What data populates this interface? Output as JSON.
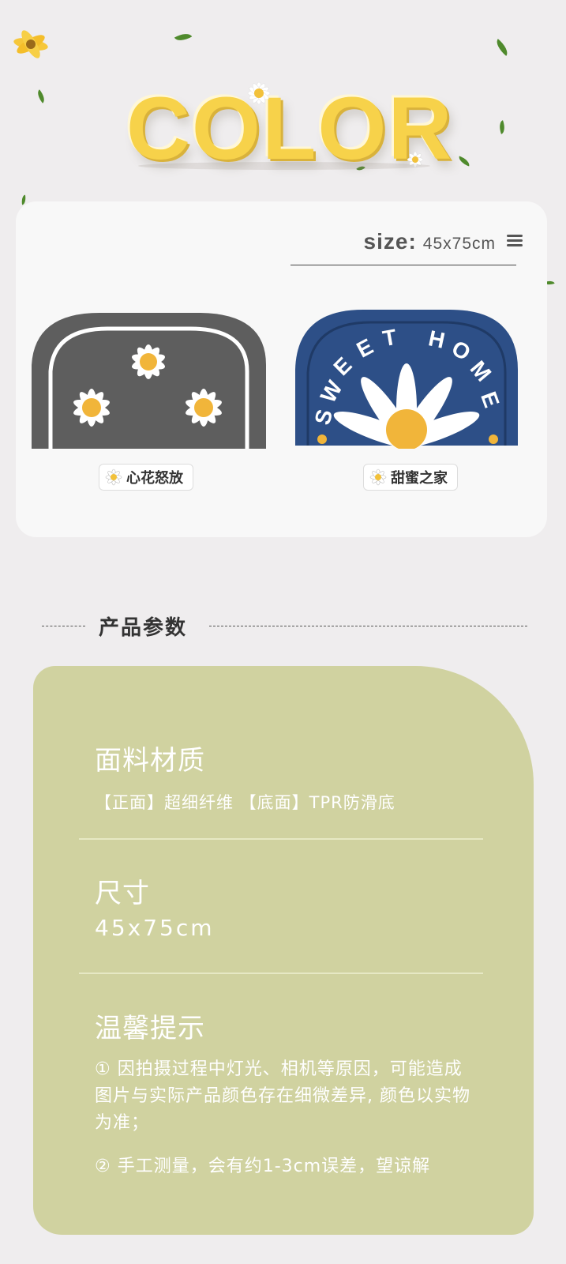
{
  "header": {
    "title": "COLOR"
  },
  "product": {
    "size_label": "size:",
    "size_value": "45x75cm",
    "variants": [
      {
        "name": "心花怒放",
        "color": "#5e5e5e"
      },
      {
        "name": "甜蜜之家",
        "color": "#2d4f87",
        "rug_text": "SWEET HOME"
      }
    ]
  },
  "params": {
    "section_title": "产品参数",
    "material": {
      "heading": "面料材质",
      "value": "【正面】超细纤维 【底面】TPR防滑底"
    },
    "size": {
      "heading": "尺寸",
      "value": "45x75cm"
    },
    "tips": {
      "heading": "温馨提示",
      "note1": "① 因拍摄过程中灯光、相机等原因，可能造成图片与实际产品颜色存在细微差异, 颜色以实物为准；",
      "note2": "② 手工测量，会有约1-3cm误差，望谅解"
    }
  },
  "colors": {
    "panel": "#d0d2a0",
    "background": "#efedee",
    "title_yellow": "#f7d24a"
  }
}
